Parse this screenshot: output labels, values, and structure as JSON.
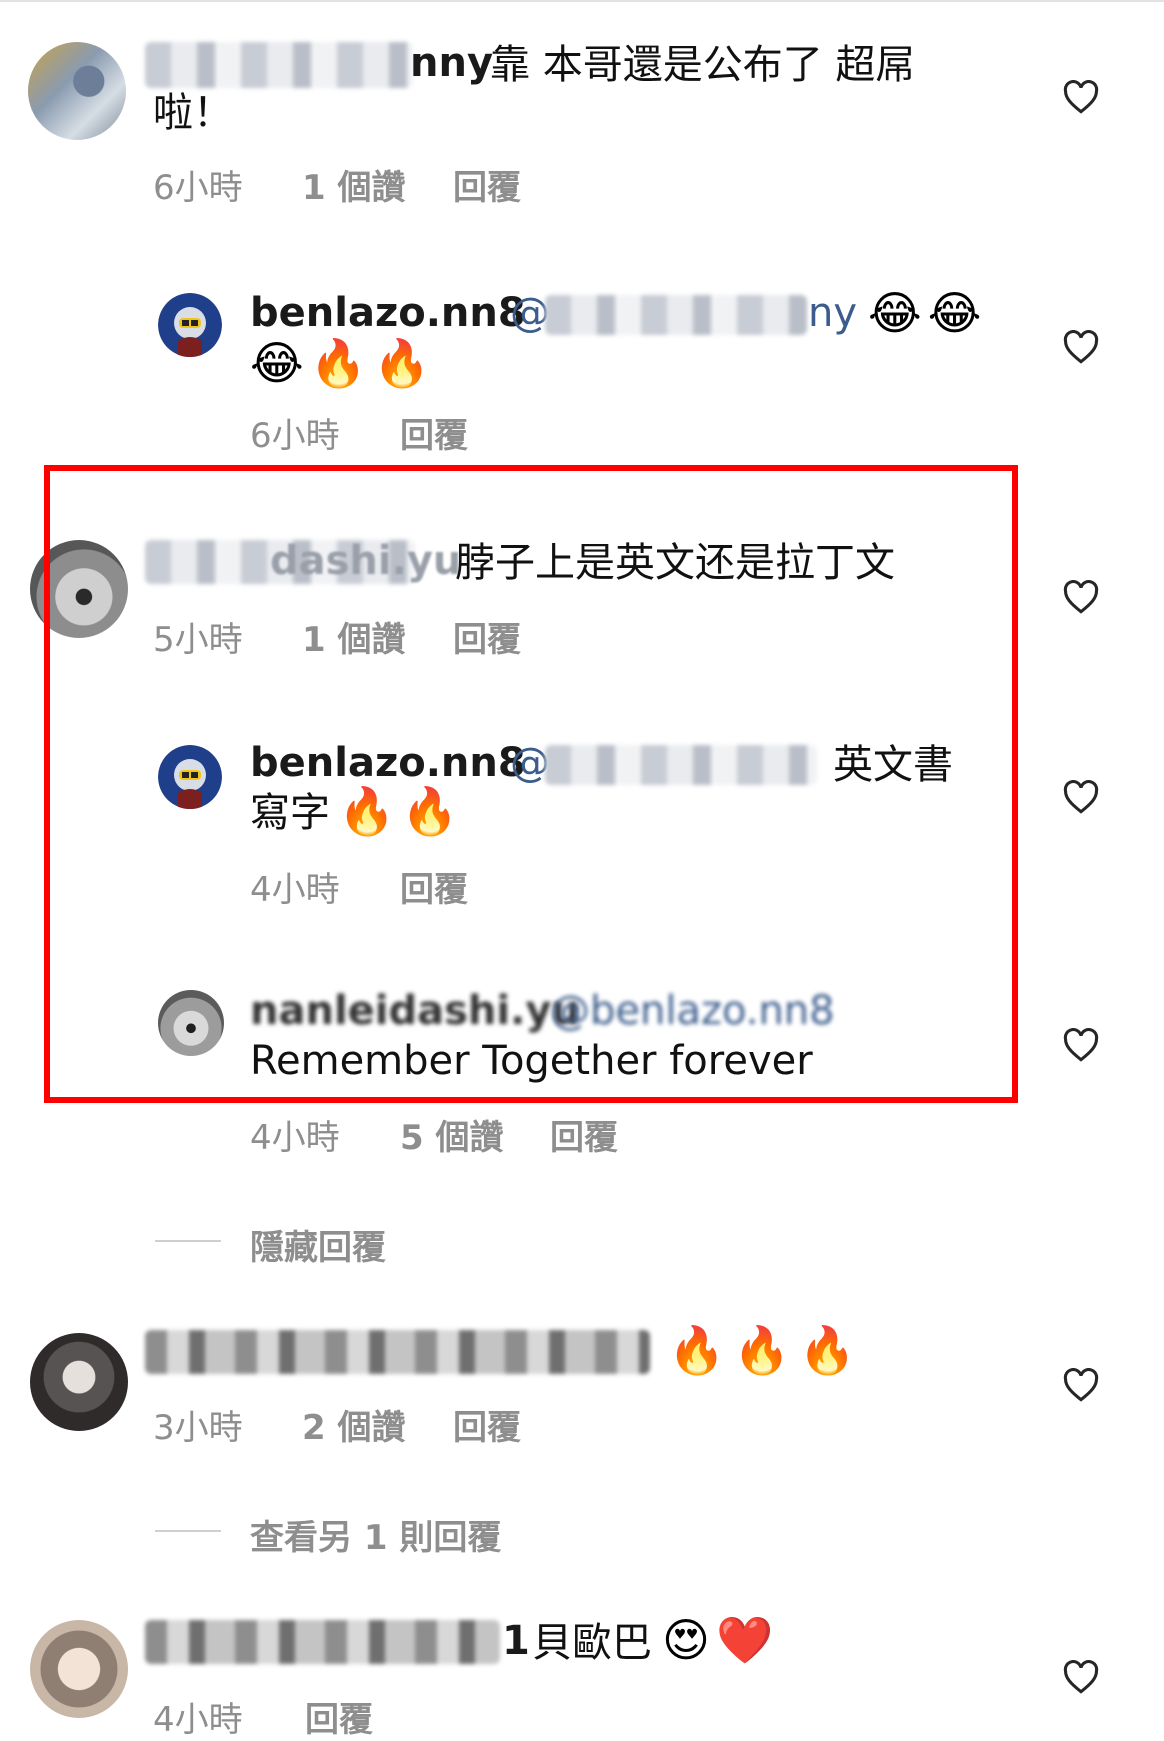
{
  "comments": [
    {
      "id": "c1",
      "username_visible_tail": "nny",
      "text_line1": "靠 本哥還是公布了 超屌",
      "text_line2": "啦！",
      "time": "6小時",
      "likes": "1 個讚",
      "reply": "回覆"
    },
    {
      "id": "c1r1",
      "username": "benlazo.nn8",
      "mention_prefix": "@",
      "mention_tail": "ny",
      "emoji_line1": "😂😂",
      "emoji_line2": "😂🔥🔥",
      "time": "6小時",
      "reply": "回覆"
    },
    {
      "id": "c2",
      "username_visible_tail": "dashi.yu",
      "text": "脖子上是英文还是拉丁文",
      "time": "5小時",
      "likes": "1 個讚",
      "reply": "回覆"
    },
    {
      "id": "c2r1",
      "username": "benlazo.nn8",
      "mention_prefix": "@",
      "text_line1": "英文書",
      "text_line2": "寫字",
      "emoji": "🔥🔥",
      "time": "4小時",
      "reply": "回覆"
    },
    {
      "id": "c2r2",
      "username": "nanleidashi.yu",
      "mention": "@benlazo.nn8",
      "text": "Remember Together forever",
      "time": "4小時",
      "likes": "5 個讚",
      "reply": "回覆"
    },
    {
      "id": "c3",
      "emoji": "🔥🔥🔥",
      "time": "3小時",
      "likes": "2 個讚",
      "reply": "回覆"
    },
    {
      "id": "c4",
      "username_visible_tail": "1",
      "text": "貝歐巴",
      "emoji": "😍❤️",
      "time": "4小時",
      "reply": "回覆"
    }
  ],
  "hide_replies_label": "隱藏回覆",
  "view_more_replies_label": "查看另 1 則回覆",
  "colors": {
    "highlight_border": "#ff0000",
    "meta_text": "#8e8e8e",
    "mention": "#3b5c8c"
  }
}
